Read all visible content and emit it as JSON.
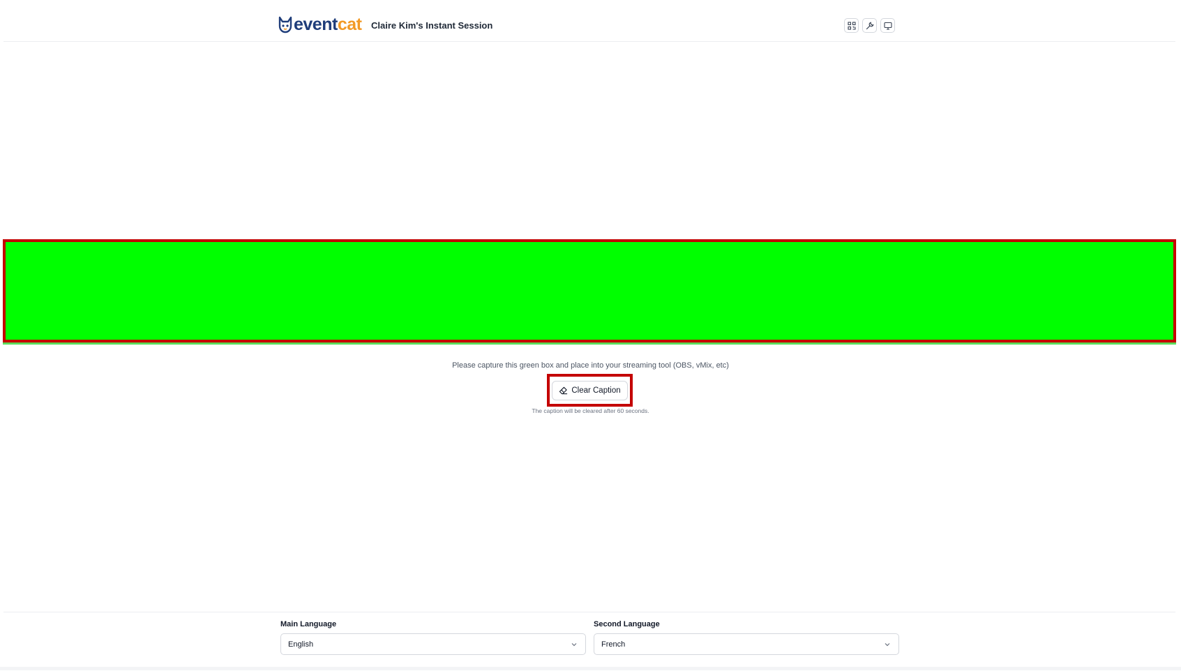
{
  "header": {
    "logo": {
      "part1": "event",
      "part2": "cat",
      "icon": "cat-logo-icon"
    },
    "session_title": "Claire Kim's Instant Session",
    "actions": [
      {
        "name": "qr-code-button",
        "icon": "qr-code-icon"
      },
      {
        "name": "settings-button",
        "icon": "wrench-icon"
      },
      {
        "name": "display-button",
        "icon": "monitor-icon"
      }
    ]
  },
  "caption": {
    "box_color": "#00ff00",
    "highlight_color": "#c40000",
    "instructions": "Please capture this green box and place into your streaming tool (OBS, vMix, etc)",
    "clear_label": "Clear Caption",
    "clear_icon": "eraser-icon",
    "clear_note": "The caption will be cleared after 60 seconds."
  },
  "languages": {
    "main": {
      "label": "Main Language",
      "value": "English"
    },
    "second": {
      "label": "Second Language",
      "value": "French"
    }
  },
  "colors": {
    "brand_primary": "#1f3d7a",
    "brand_accent": "#f29a26"
  }
}
